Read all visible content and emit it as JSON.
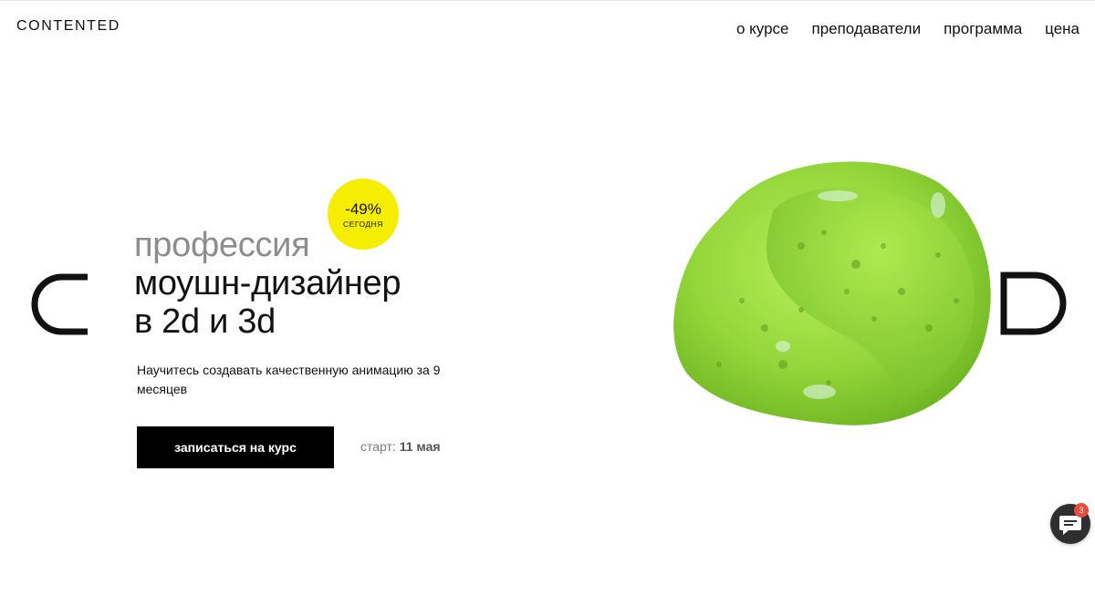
{
  "header": {
    "logo": "CONTENTED",
    "nav": [
      {
        "label": "о курсе"
      },
      {
        "label": "преподаватели"
      },
      {
        "label": "программа"
      },
      {
        "label": "цена"
      }
    ]
  },
  "hero": {
    "title_line1": "профессия",
    "title_line2": "моушн-дизайнер",
    "title_line3": "в 2d и 3d",
    "badge_percent": "-49%",
    "badge_note": "СЕГОДНЯ",
    "subtitle": "Научитесь создавать качественную анимацию за 9 месяцев",
    "cta_label": "записаться на курс",
    "start_prefix": "старт:",
    "start_date": "11 мая"
  },
  "chat": {
    "unread_count": "3",
    "icon": "chat-bubble-icon"
  },
  "colors": {
    "badge": "#f6ee00",
    "cta_bg": "#000000",
    "blob": "#9bdc3c",
    "chat_badge": "#e84d3d"
  }
}
